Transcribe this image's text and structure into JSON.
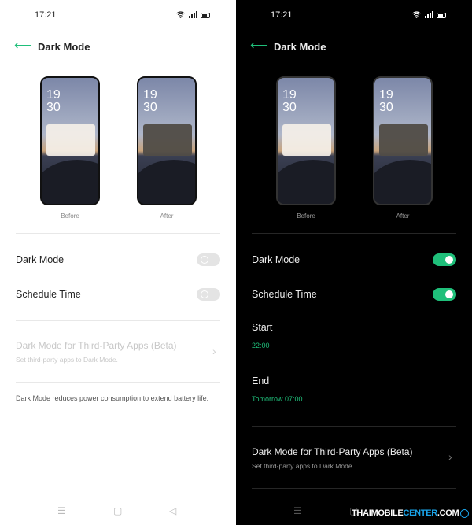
{
  "status_bar": {
    "time": "17:21",
    "icons": [
      "wifi-icon",
      "signal-icon",
      "battery-icon"
    ]
  },
  "header": {
    "back_icon": "arrow-left-icon",
    "title": "Dark Mode"
  },
  "previews": {
    "before_clock": "19\n30",
    "after_clock": "19\n30",
    "before_label": "Before",
    "after_label": "After"
  },
  "light_screen": {
    "rows": {
      "dark_mode": {
        "label": "Dark Mode",
        "enabled": false
      },
      "schedule": {
        "label": "Schedule Time",
        "enabled": false
      }
    },
    "third_party": {
      "title": "Dark Mode for Third-Party Apps (Beta)",
      "subtitle": "Set third-party apps to Dark Mode."
    },
    "footnote": "Dark Mode reduces power consumption to extend battery life."
  },
  "dark_screen": {
    "rows": {
      "dark_mode": {
        "label": "Dark Mode",
        "enabled": true
      },
      "schedule": {
        "label": "Schedule Time",
        "enabled": true
      }
    },
    "start": {
      "label": "Start",
      "value": "22:00"
    },
    "end": {
      "label": "End",
      "value": "Tomorrow 07:00"
    },
    "third_party": {
      "title": "Dark Mode for Third-Party Apps (Beta)",
      "subtitle": "Set third-party apps to Dark Mode."
    }
  },
  "nav_bar": {
    "icons": [
      "menu-icon",
      "home-icon",
      "back-triangle-icon"
    ],
    "menu_glyph": "☰",
    "home_glyph": "▢",
    "back_glyph": "◁"
  },
  "watermark": {
    "part1": "THAIMOBILE",
    "part2": "CENTER",
    "part3": ".COM"
  },
  "colors": {
    "accent": "#1fbf7a",
    "dark_bg": "#000000",
    "light_bg": "#ffffff"
  }
}
